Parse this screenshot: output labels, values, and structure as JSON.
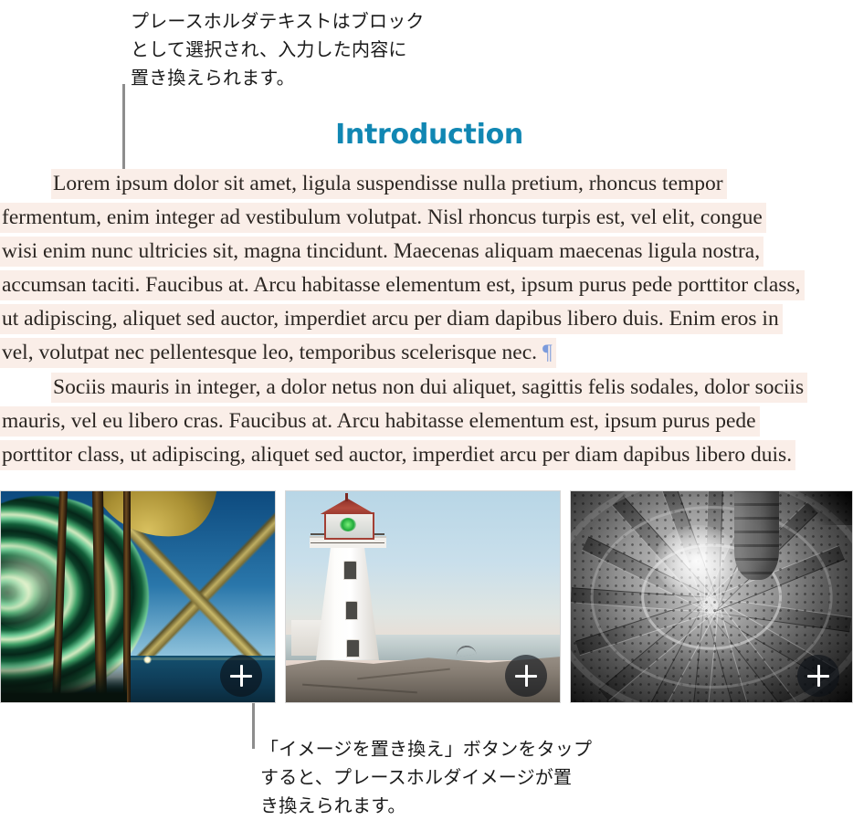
{
  "callouts": {
    "top": {
      "text": "プレースホルダテキストはブロック\nとして選択され、入力した内容に\n置き換えられます。"
    },
    "bottom": {
      "text": "「イメージを置き換え」ボタンをタップ\nすると、プレースホルダイメージが置\nき換えられます。"
    }
  },
  "document": {
    "heading": "Introduction",
    "heading_color": "#1187b3",
    "highlight_color": "#faeee8",
    "pilcrow_color": "#7b9bdc",
    "paragraph_1": {
      "lines": [
        "Lorem ipsum dolor sit amet, ligula suspendisse nulla pretium, rhoncus tempor",
        "fermentum, enim integer ad vestibulum volutpat. Nisl rhoncus turpis est, vel elit, congue",
        "wisi enim nunc ultricies sit, magna tincidunt. Maecenas aliquam maecenas ligula nostra,",
        "accumsan taciti. Faucibus at. Arcu habitasse elementum est, ipsum purus pede porttitor class,",
        "ut adipiscing, aliquet sed auctor, imperdiet arcu per diam dapibus libero duis. Enim eros in",
        "vel, volutpat nec pellentesque leo, temporibus scelerisque nec."
      ],
      "end_mark": "¶"
    },
    "paragraph_2": {
      "lines": [
        "Sociis mauris in integer, a dolor netus non dui aliquet, sagittis felis sodales, dolor sociis",
        "mauris, vel eu libero cras. Faucibus at. Arcu habitasse elementum est, ipsum purus pede",
        "porttitor class, ut adipiscing, aliquet sed auctor, imperdiet arcu per diam dapibus libero duis."
      ]
    }
  },
  "images": [
    {
      "name": "lighthouse-fresnel-lens",
      "replace_button_icon": "plus-icon"
    },
    {
      "name": "peggys-cove-lighthouse",
      "replace_button_icon": "plus-icon"
    },
    {
      "name": "spiral-staircase",
      "replace_button_icon": "plus-icon"
    }
  ]
}
